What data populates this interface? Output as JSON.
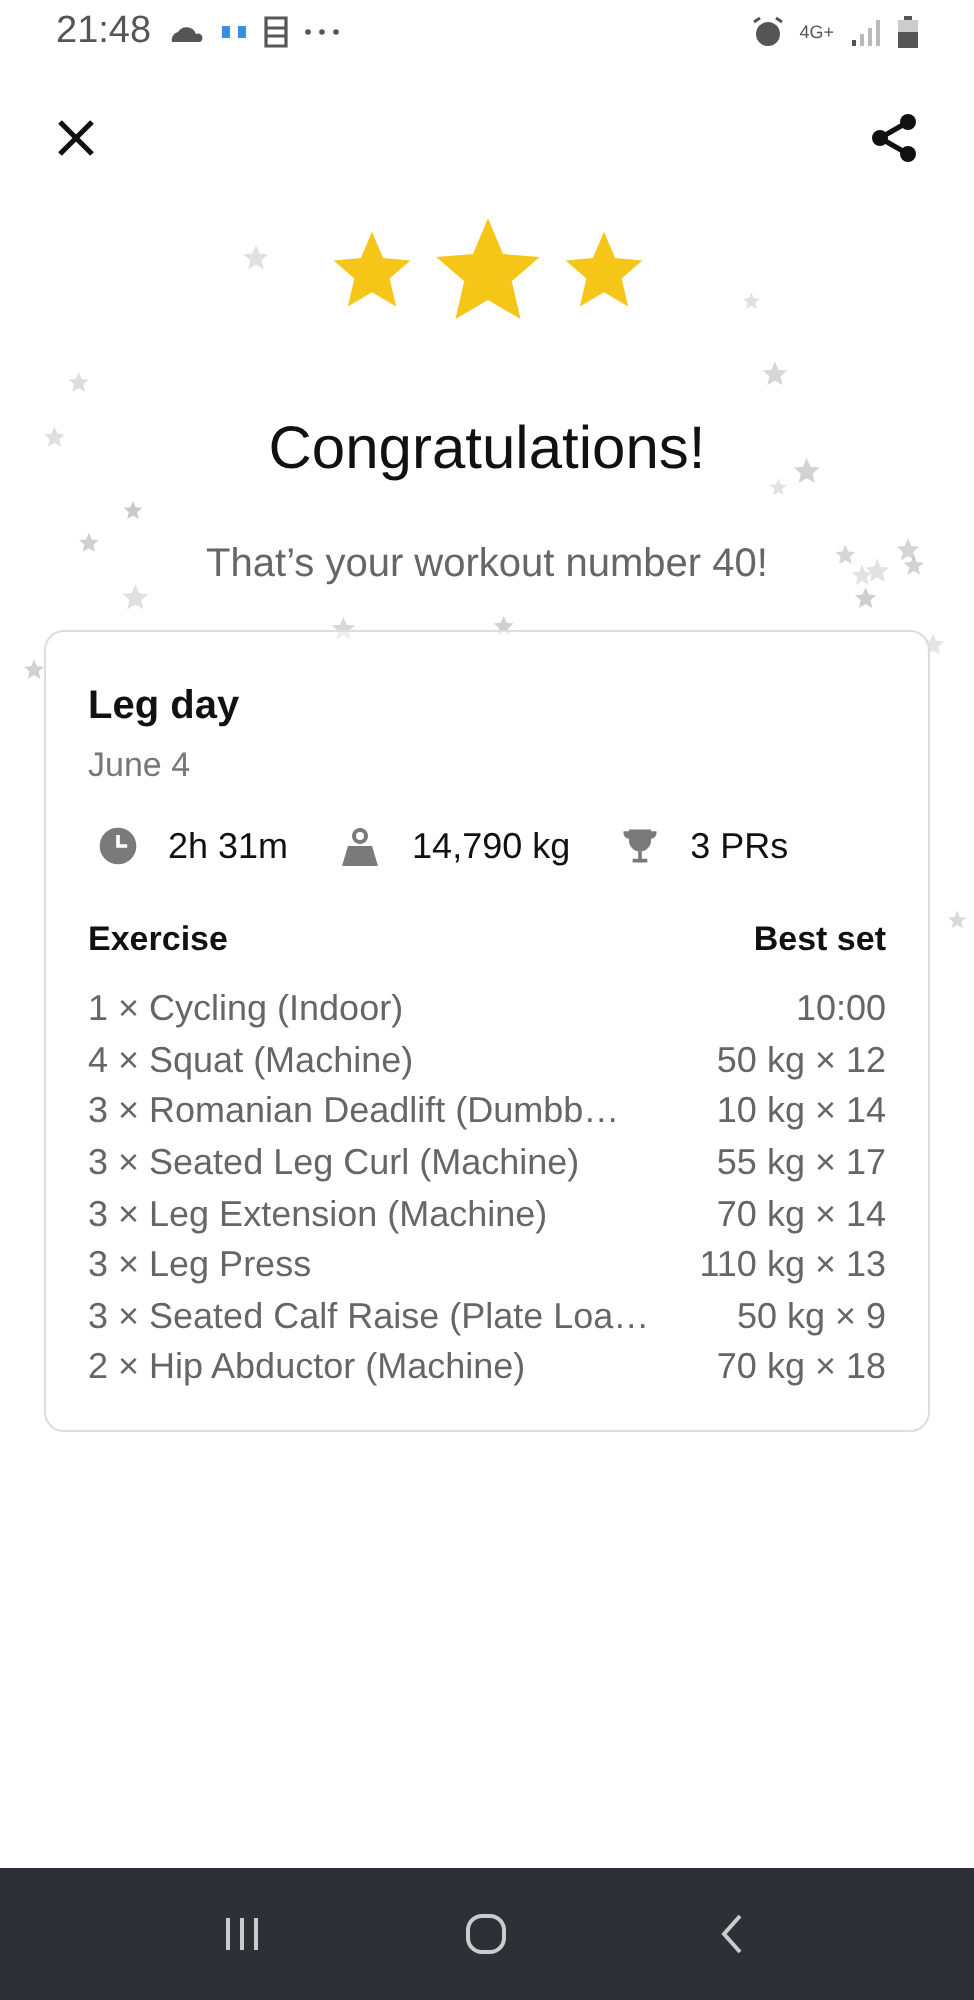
{
  "status_bar": {
    "time": "21:48",
    "network": "4G+"
  },
  "rating": {
    "stars": 3
  },
  "title": "Congratulations!",
  "subtitle": "That’s your workout number 40!",
  "workout": {
    "name": "Leg day",
    "date": "June 4",
    "stats": [
      {
        "kind": "duration",
        "value": "2h 31m"
      },
      {
        "kind": "weight",
        "value": "14,790 kg"
      },
      {
        "kind": "records",
        "value": "3 PRs"
      }
    ],
    "columns": [
      "Exercise",
      "Best set"
    ],
    "rows": [
      {
        "exercise": "1 × Cycling (Indoor)",
        "best_set": "10:00"
      },
      {
        "exercise": "4 × Squat (Machine)",
        "best_set": "50 kg × 12"
      },
      {
        "exercise": "3 × Romanian Deadlift (Dumbb…",
        "best_set": "10 kg × 14"
      },
      {
        "exercise": "3 × Seated Leg Curl (Machine)",
        "best_set": "55 kg × 17"
      },
      {
        "exercise": "3 × Leg Extension (Machine)",
        "best_set": "70 kg × 14"
      },
      {
        "exercise": "3 × Leg Press",
        "best_set": "110 kg × 13"
      },
      {
        "exercise": "3 × Seated Calf Raise (Plate Loa…",
        "best_set": "50 kg × 9"
      },
      {
        "exercise": "2 × Hip Abductor (Machine)",
        "best_set": "70 kg × 18"
      }
    ]
  }
}
